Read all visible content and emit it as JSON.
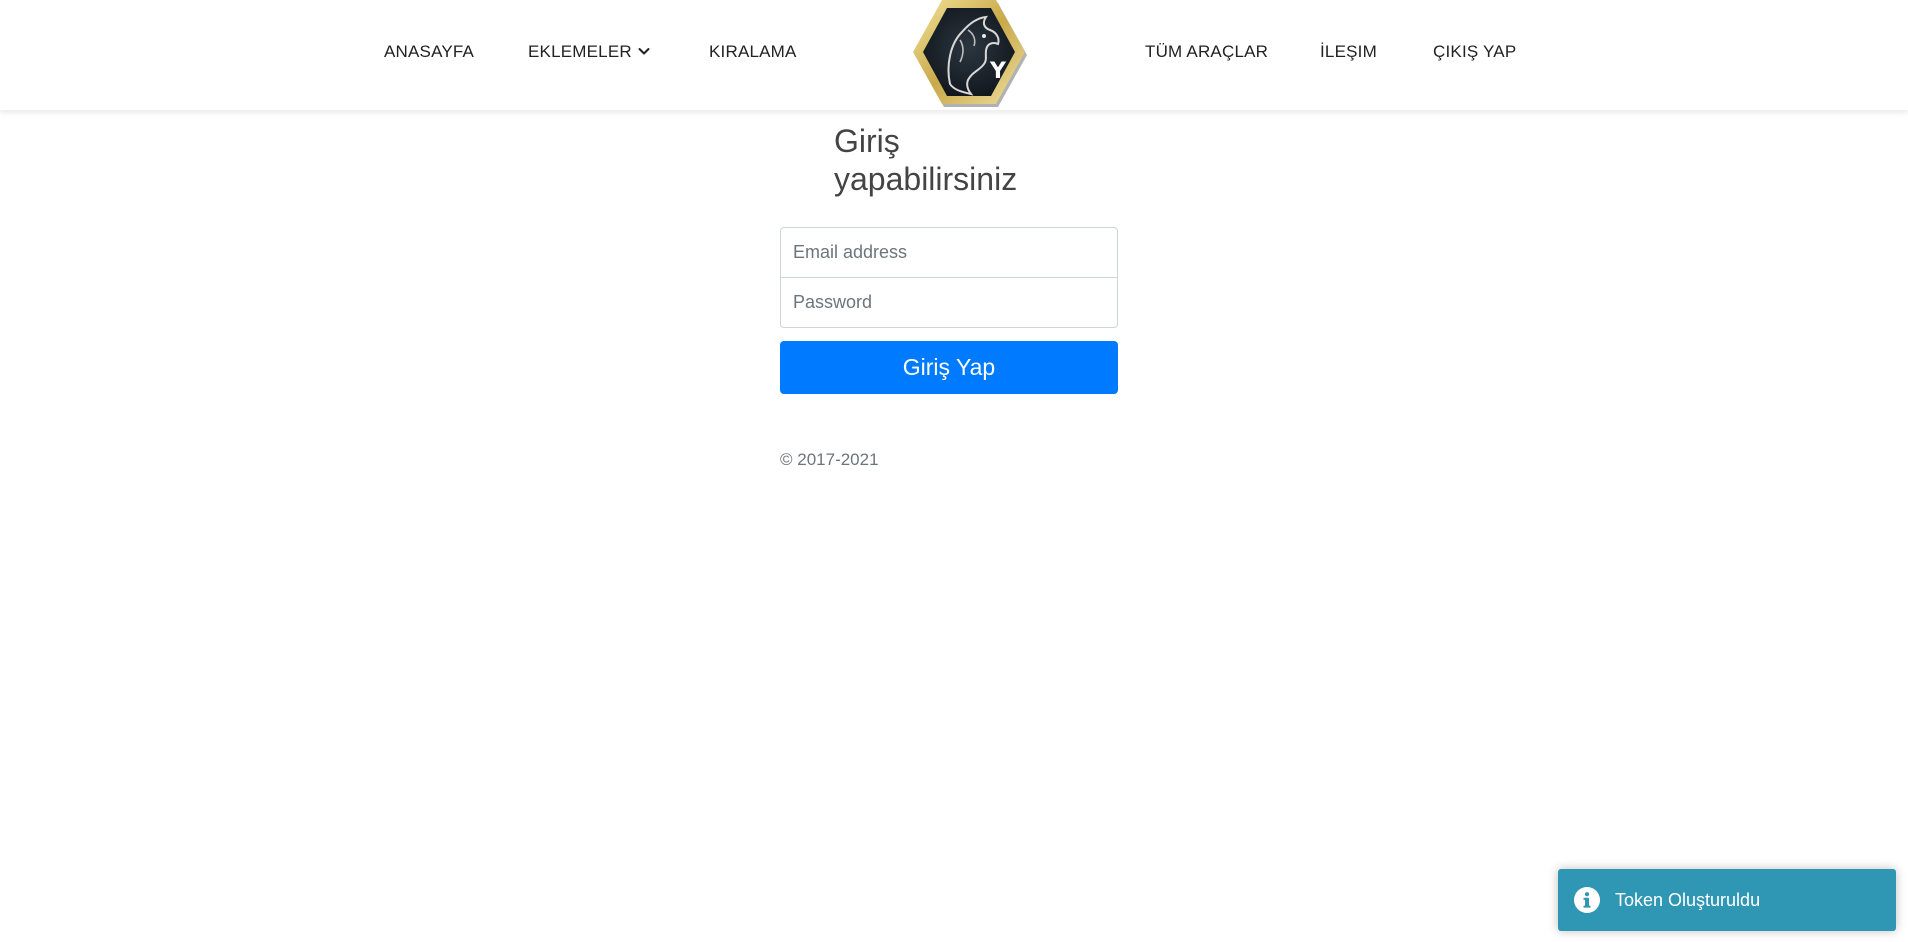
{
  "nav": {
    "home": "ANASAYFA",
    "addons": "EKLEMELER",
    "rental": "KIRALAMA",
    "all_vehicles": "TÜM ARAÇLAR",
    "contact": "İLEŞIM",
    "logout": "ÇIKIŞ YAP",
    "logo_letter": "Y"
  },
  "login": {
    "title": "Giriş yapabilirsiniz",
    "email_placeholder": "Email address",
    "email_value": "",
    "password_placeholder": "Password",
    "password_value": "",
    "submit_label": "Giriş Yap"
  },
  "footer": {
    "copyright": "© 2017-2021"
  },
  "toast": {
    "icon": "info-icon",
    "message": "Token Oluşturuldu"
  },
  "colors": {
    "primary_button": "#007bff",
    "toast_info": "#2f96b4",
    "logo_gold": "#e0c060"
  }
}
